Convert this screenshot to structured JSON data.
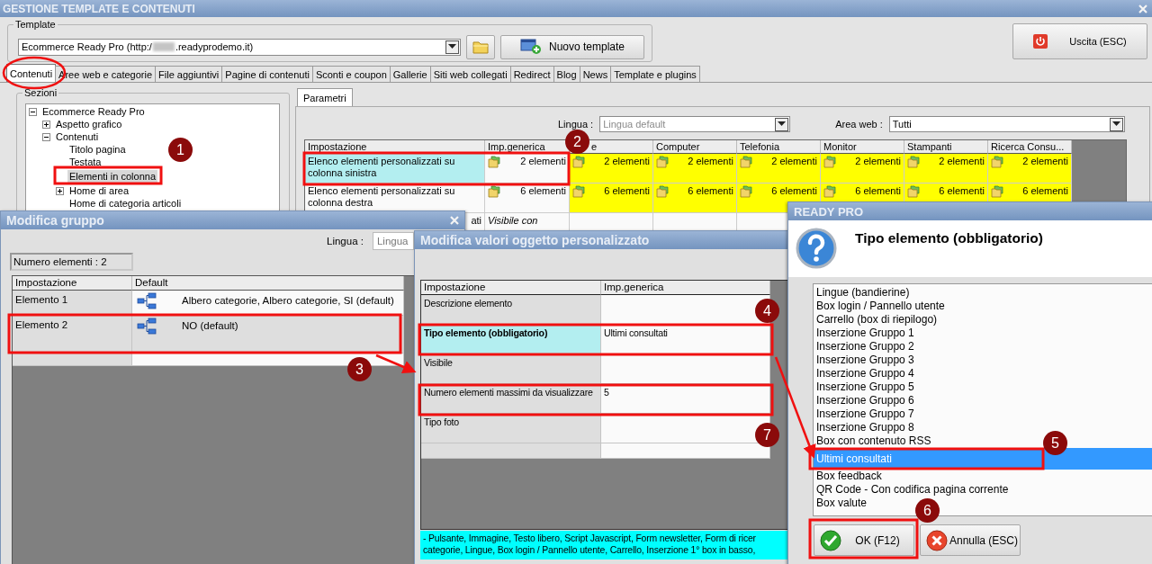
{
  "main_window": {
    "title": "GESTIONE TEMPLATE E CONTENUTI",
    "template": {
      "label": "Template",
      "combo_prefix": "Ecommerce Ready Pro (http:/",
      "combo_suffix": ".readyprodemo.it)",
      "new_button": "Nuovo template"
    },
    "exit_button": "Uscita (ESC)",
    "tabs": [
      {
        "label": "Contenuti",
        "selected": true
      },
      {
        "label": "Aree web e categorie",
        "selected": false
      },
      {
        "label": "File aggiuntivi",
        "selected": false
      },
      {
        "label": "Pagine di contenuti",
        "selected": false
      },
      {
        "label": "Sconti e coupon",
        "selected": false
      },
      {
        "label": "Gallerie",
        "selected": false
      },
      {
        "label": "Siti web collegati",
        "selected": false
      },
      {
        "label": "Redirect",
        "selected": false
      },
      {
        "label": "Blog",
        "selected": false
      },
      {
        "label": "News",
        "selected": false
      },
      {
        "label": "Template e plugins",
        "selected": false
      }
    ],
    "sections": {
      "label": "Sezioni",
      "tree": [
        {
          "label": "Ecommerce Ready Pro",
          "expanded": true,
          "selected": false,
          "children": [
            {
              "label": "Aspetto grafico",
              "expanded": false,
              "selected": false
            },
            {
              "label": "Contenuti",
              "expanded": true,
              "selected": false,
              "children": [
                {
                  "label": "Titolo pagina",
                  "selected": false
                },
                {
                  "label": "Testata",
                  "selected": false
                },
                {
                  "label": "Elementi in colonna",
                  "selected": true
                },
                {
                  "label": "Home di area",
                  "expanded": false,
                  "selected": false
                },
                {
                  "label": "Home di categoria articoli",
                  "selected": false
                }
              ]
            }
          ]
        }
      ]
    },
    "param_tabs": [
      {
        "label": "Parametri",
        "selected": true
      }
    ],
    "language": {
      "label": "Lingua :",
      "value": "Lingua default"
    },
    "area": {
      "label": "Area web :",
      "value": "Tutti"
    },
    "grid": {
      "columns": [
        "Impostazione",
        "Imp.generica",
        "e",
        "Computer",
        "Telefonia",
        "Monitor",
        "Stampanti",
        "Ricerca Consu..."
      ],
      "rows": [
        {
          "selected": true,
          "clipped_start": false,
          "setting": "Elenco elementi personalizzati su colonna sinistra",
          "generic": {
            "kind": "count",
            "text": "2 elementi"
          },
          "values": [
            {
              "kind": "count",
              "text": "2 elementi",
              "customized": true
            },
            {
              "kind": "count",
              "text": "2 elementi",
              "customized": true
            },
            {
              "kind": "count",
              "text": "2 elementi",
              "customized": true
            },
            {
              "kind": "count",
              "text": "2 elementi",
              "customized": true
            },
            {
              "kind": "count",
              "text": "2 elementi",
              "customized": true
            },
            {
              "kind": "count",
              "text": "2 elementi",
              "customized": true
            }
          ]
        },
        {
          "selected": false,
          "clipped_start": false,
          "setting": "Elenco elementi personalizzati su colonna destra",
          "generic": {
            "kind": "count",
            "text": "6 elementi"
          },
          "values": [
            {
              "kind": "count",
              "text": "6 elementi",
              "customized": true
            },
            {
              "kind": "count",
              "text": "6 elementi",
              "customized": true
            },
            {
              "kind": "count",
              "text": "6 elementi",
              "customized": true
            },
            {
              "kind": "count",
              "text": "6 elementi",
              "customized": true
            },
            {
              "kind": "count",
              "text": "6 elementi",
              "customized": true
            },
            {
              "kind": "count",
              "text": "6 elementi",
              "customized": true
            }
          ]
        },
        {
          "selected": false,
          "clipped_start": true,
          "setting": "ati",
          "generic": {
            "kind": "note",
            "text": "Visibile con"
          },
          "values": []
        }
      ]
    }
  },
  "group_dialog": {
    "title": "Modifica gruppo",
    "language_label": "Lingua :",
    "language_value": "Lingua",
    "count": "Numero elementi : 2",
    "columns": [
      "Impostazione",
      "Default"
    ],
    "rows": [
      {
        "setting": "Elemento 1",
        "value": "Albero categorie, Albero categorie, SI (default)",
        "selected": false
      },
      {
        "setting": "Elemento 2",
        "value": "NO (default)",
        "selected": true
      }
    ]
  },
  "values_dialog": {
    "title": "Modifica valori oggetto personalizzato",
    "columns": [
      "Impostazione",
      "Imp.generica"
    ],
    "rows": [
      {
        "setting": "Descrizione elemento",
        "selected": false
      },
      {
        "setting": "Tipo elemento (obbligatorio)",
        "value": "Ultimi consultati",
        "selected": true
      },
      {
        "setting": "Visibile",
        "selected": false
      },
      {
        "setting": "Numero elementi massimi da visualizzare",
        "value": "5",
        "selected": false
      },
      {
        "setting": "Tipo foto",
        "selected": false
      }
    ],
    "help_lines": [
      "- Pulsante, Immagine, Testo libero, Script Javascript, Form newsletter, Form di ricer",
      "categorie, Lingue, Box login / Pannello utente, Carrello, Inserzione 1° box in basso,"
    ]
  },
  "choice_dialog": {
    "title": "READY PRO",
    "question": "Tipo elemento (obbligatorio)",
    "options": [
      {
        "label": "Lingue (bandierine)",
        "selected": false
      },
      {
        "label": "Box login / Pannello utente",
        "selected": false
      },
      {
        "label": "Carrello (box di riepilogo)",
        "selected": false
      },
      {
        "label": "Inserzione Gruppo 1",
        "selected": false
      },
      {
        "label": "Inserzione Gruppo 2",
        "selected": false
      },
      {
        "label": "Inserzione Gruppo 3",
        "selected": false
      },
      {
        "label": "Inserzione Gruppo 4",
        "selected": false
      },
      {
        "label": "Inserzione Gruppo 5",
        "selected": false
      },
      {
        "label": "Inserzione Gruppo 6",
        "selected": false
      },
      {
        "label": "Inserzione Gruppo 7",
        "selected": false
      },
      {
        "label": "Inserzione Gruppo 8",
        "selected": false
      },
      {
        "label": "Box con contenuto RSS",
        "selected": false
      },
      {
        "label": "Ultimi consultati",
        "selected": true
      },
      {
        "label": "Box feedback",
        "selected": false
      },
      {
        "label": "QR Code - Con codifica pagina corrente",
        "selected": false
      },
      {
        "label": "Box valute",
        "selected": false
      }
    ],
    "buttons": [
      {
        "kind": "ok",
        "label": "OK (F12)"
      },
      {
        "kind": "cancel",
        "label": "Annulla (ESC)"
      }
    ]
  },
  "annotations": {
    "badges": [
      "1",
      "2",
      "3",
      "4",
      "5",
      "6",
      "7"
    ]
  }
}
